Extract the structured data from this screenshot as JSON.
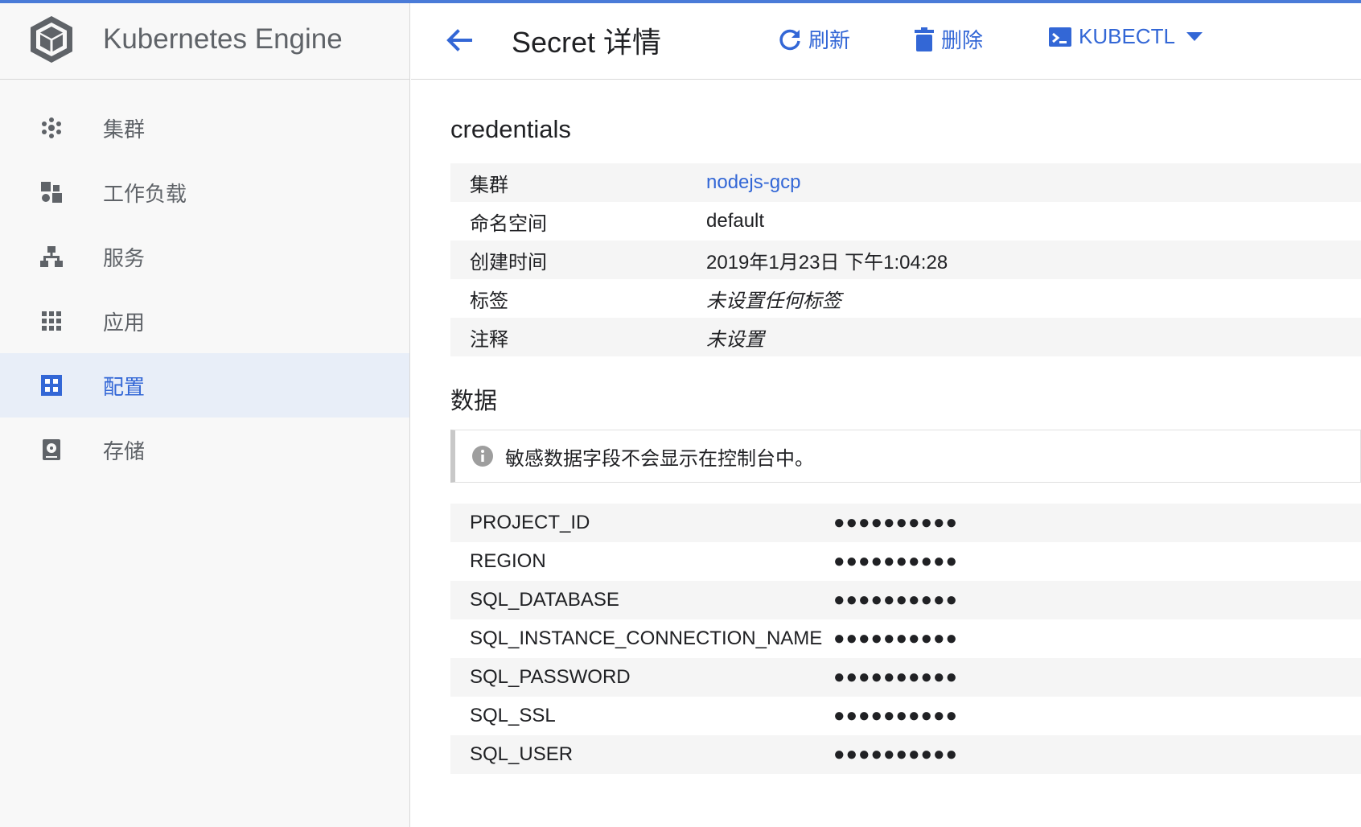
{
  "app": {
    "title": "Kubernetes Engine"
  },
  "sidebar": {
    "items": [
      {
        "label": "集群",
        "icon": "clusters-icon",
        "active": false
      },
      {
        "label": "工作负载",
        "icon": "workloads-icon",
        "active": false
      },
      {
        "label": "服务",
        "icon": "services-icon",
        "active": false
      },
      {
        "label": "应用",
        "icon": "applications-icon",
        "active": false
      },
      {
        "label": "配置",
        "icon": "configuration-icon",
        "active": true
      },
      {
        "label": "存储",
        "icon": "storage-icon",
        "active": false
      }
    ]
  },
  "header": {
    "title": "Secret 详情",
    "refresh_label": "刷新",
    "delete_label": "删除",
    "kubectl_label": "KUBECTL"
  },
  "secret": {
    "name": "credentials",
    "details": [
      {
        "key": "集群",
        "value": "nodejs-gcp",
        "style": "link"
      },
      {
        "key": "命名空间",
        "value": "default",
        "style": "plain"
      },
      {
        "key": "创建时间",
        "value": "2019年1月23日 下午1:04:28",
        "style": "plain"
      },
      {
        "key": "标签",
        "value": "未设置任何标签",
        "style": "italic"
      },
      {
        "key": "注释",
        "value": "未设置",
        "style": "italic"
      }
    ],
    "data_title": "数据",
    "notice": "敏感数据字段不会显示在控制台中。",
    "data": [
      {
        "key": "PROJECT_ID",
        "value": "●●●●●●●●●●"
      },
      {
        "key": "REGION",
        "value": "●●●●●●●●●●"
      },
      {
        "key": "SQL_DATABASE",
        "value": "●●●●●●●●●●"
      },
      {
        "key": "SQL_INSTANCE_CONNECTION_NAME",
        "value": "●●●●●●●●●●"
      },
      {
        "key": "SQL_PASSWORD",
        "value": "●●●●●●●●●●"
      },
      {
        "key": "SQL_SSL",
        "value": "●●●●●●●●●●"
      },
      {
        "key": "SQL_USER",
        "value": "●●●●●●●●●●"
      }
    ]
  },
  "colors": {
    "accent": "#3367d6",
    "active_bg": "#e8eef8",
    "icon_gray": "#5f6368"
  }
}
